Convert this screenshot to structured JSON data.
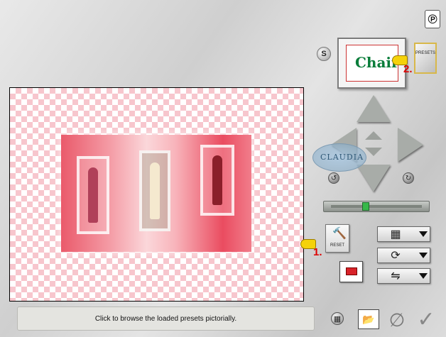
{
  "header": {
    "logo_glyph": "℗",
    "s_label": "S",
    "preset_thumb_text": "Chair",
    "presets_label": "PRESETS"
  },
  "preview": {
    "watermark_text": "CLAUDIA"
  },
  "controls": {
    "reset_label": "RESET",
    "hammer_glyph": "🔨",
    "rotate_left_glyph": "↺",
    "rotate_right_glyph": "↻",
    "grid_glyph": "▦",
    "rotate_glyph": "⟳",
    "flip_glyph": "⇋",
    "zoom_level": 0.4
  },
  "steps": {
    "step1": "1.",
    "step2": "2."
  },
  "status": {
    "text": "Click to browse the loaded presets pictorially."
  },
  "footer": {
    "grid_glyph": "▦",
    "folder_glyph": "📂",
    "cancel_glyph": "∅",
    "ok_glyph": "✓"
  },
  "colors": {
    "checker": "#f7c6cd",
    "status_bg": "#e4e4e0",
    "accent_red": "#d00"
  }
}
